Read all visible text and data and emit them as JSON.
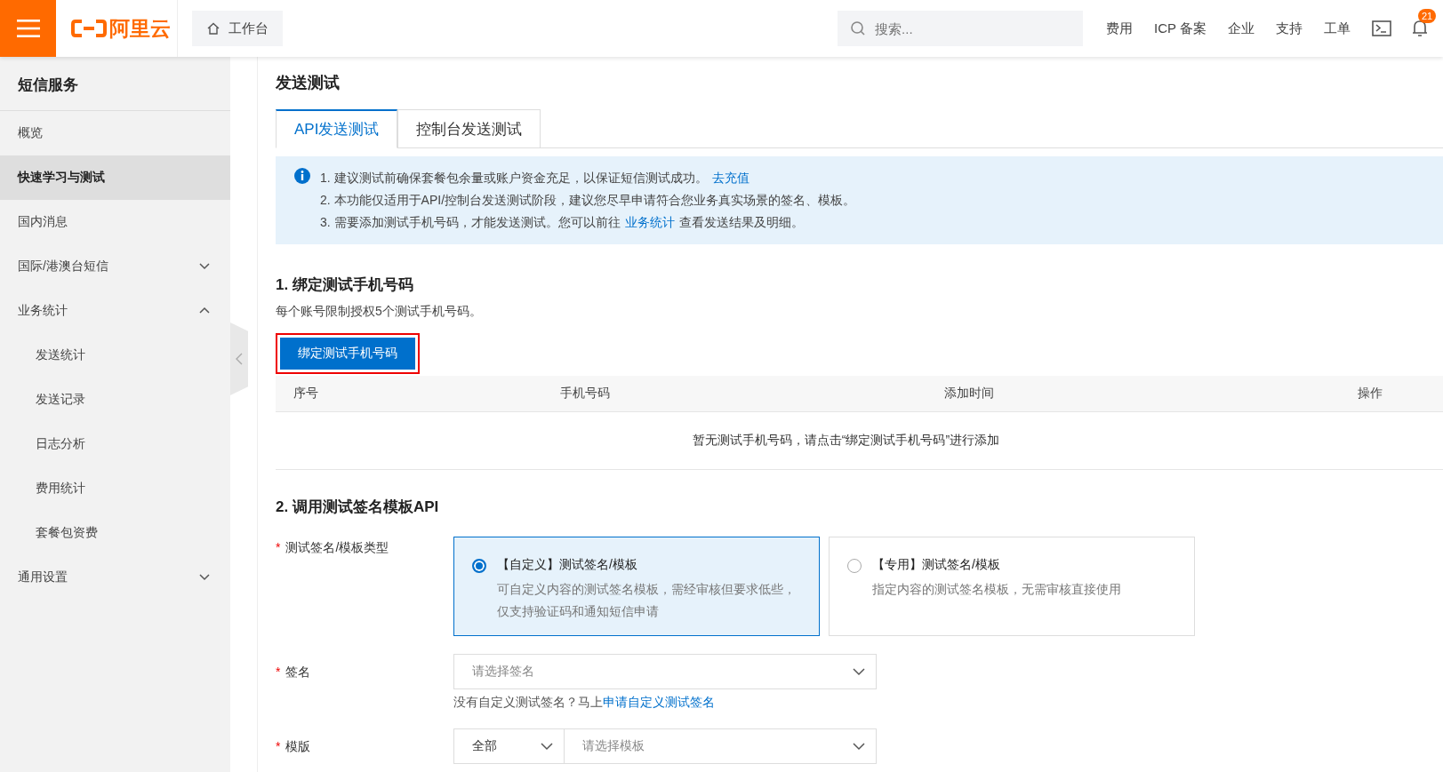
{
  "topbar": {
    "logo": "阿里云",
    "workbench": "工作台",
    "search": {
      "placeholder": "搜索..."
    },
    "links": [
      "费用",
      "ICP 备案",
      "企业",
      "支持",
      "工单"
    ],
    "notification_count": "21"
  },
  "sidebar": {
    "title": "短信服务",
    "items": [
      {
        "label": "概览",
        "selected": false
      },
      {
        "label": "快速学习与测试",
        "selected": true
      },
      {
        "label": "国内消息",
        "selected": false
      },
      {
        "label": "国际/港澳台短信",
        "selected": false,
        "expanded": false
      },
      {
        "label": "业务统计",
        "selected": false,
        "expanded": true,
        "children": [
          {
            "label": "发送统计",
            "selected": false
          },
          {
            "label": "发送记录",
            "selected": false
          },
          {
            "label": "日志分析",
            "selected": false
          },
          {
            "label": "费用统计",
            "selected": false
          },
          {
            "label": "套餐包资费",
            "selected": false
          }
        ]
      },
      {
        "label": "通用设置",
        "selected": false,
        "expanded": false
      }
    ]
  },
  "page_title": "发送测试",
  "tabs": [
    {
      "label": "API发送测试",
      "selected": true
    },
    {
      "label": "控制台发送测试",
      "selected": false
    }
  ],
  "notice": [
    [
      {
        "text": "1. 建议测试前确保套餐包余量或账户资金充足，以保证短信测试成功。",
        "link": false
      },
      {
        "text": "去充值",
        "link": true
      }
    ],
    [
      {
        "text": "2. 本功能仅适用于API/控制台发送测试阶段，建议您尽早申请符合您业务真实场景的签名、模板。",
        "link": false
      }
    ],
    [
      {
        "text": "3. 需要添加测试手机号码，才能发送测试。您可以前往",
        "link": false
      },
      {
        "text": "业务统计",
        "link": true
      },
      {
        "text": "查看发送结果及明细。",
        "link": false
      }
    ]
  ],
  "section1": {
    "title": "1. 绑定测试手机号码",
    "hint": "每个账号限制授权5个测试手机号码。",
    "button": {
      "label": "绑定测试手机号码",
      "highlighted": true
    },
    "table": {
      "columns": [
        "序号",
        "手机号码",
        "添加时间",
        "操作"
      ],
      "empty": "暂无测试手机号码，请点击“绑定测试手机号码”进行添加"
    }
  },
  "section2": {
    "title": "2. 调用测试签名模板API",
    "type_field": {
      "required_mark": "*",
      "label": "测试签名/模板类型",
      "options": [
        {
          "title": "【自定义】测试签名/模板",
          "description": "可自定义内容的测试签名模板，需经审核但要求低些，仅支持验证码和通知短信申请",
          "selected": true
        },
        {
          "title": "【专用】测试签名/模板",
          "description": "指定内容的测试签名模板，无需审核直接使用",
          "selected": false
        }
      ]
    },
    "sign_field": {
      "required_mark": "*",
      "label": "签名",
      "placeholder": "请选择签名",
      "help": "没有自定义测试签名？马上",
      "help_link": "申请自定义测试签名"
    },
    "template_field": {
      "required_mark": "*",
      "label": "模版",
      "category": "全部",
      "placeholder": "请选择模板"
    }
  }
}
